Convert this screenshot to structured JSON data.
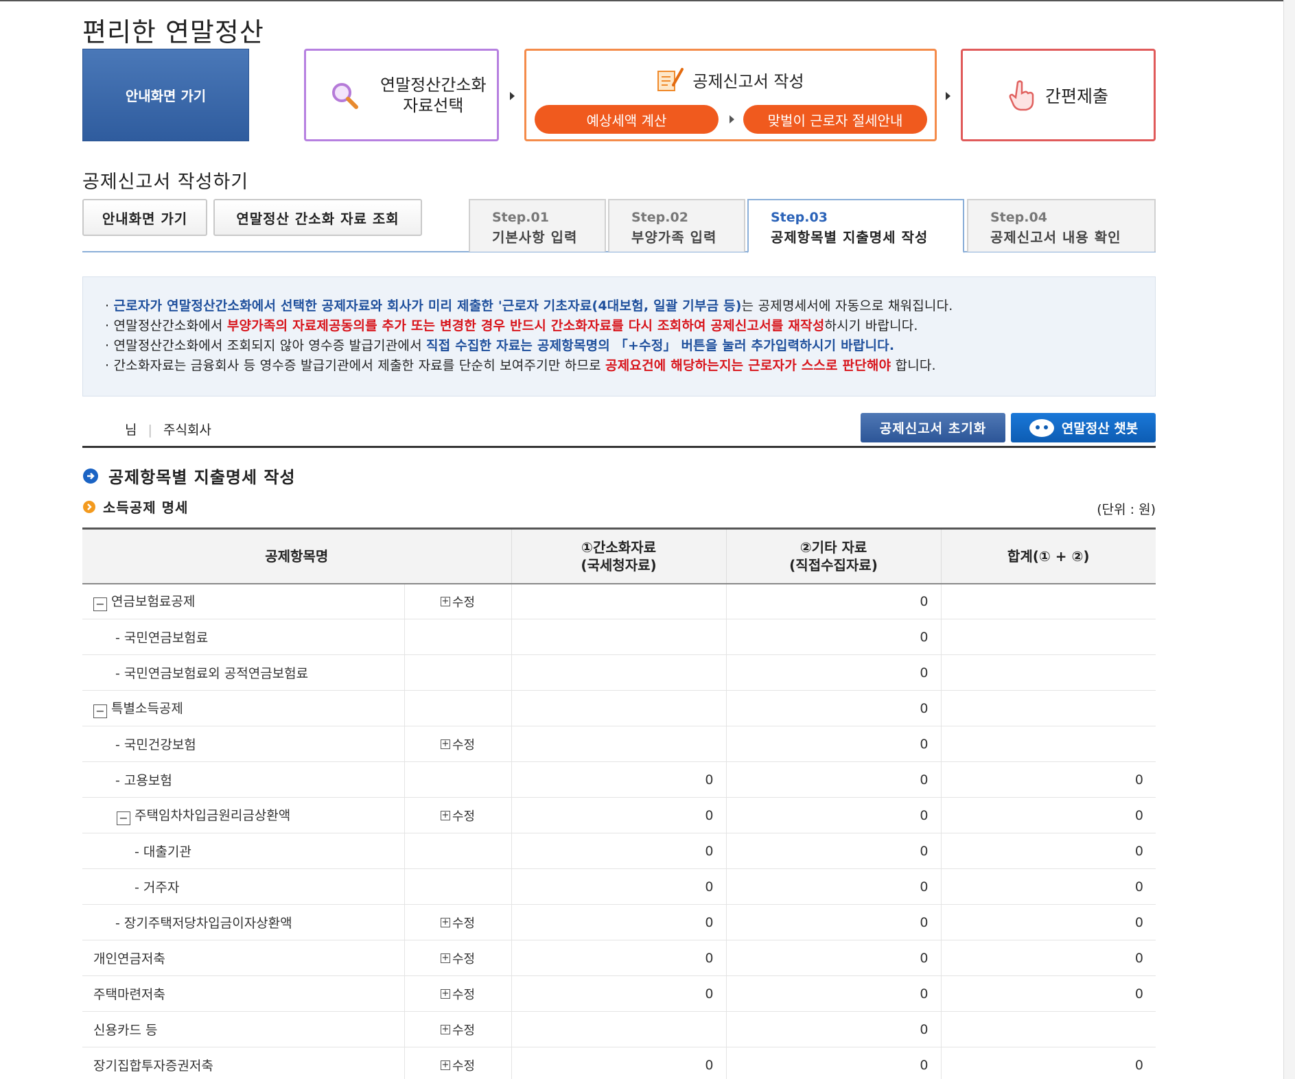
{
  "app_title": "편리한 연말정산",
  "process": {
    "guide_button": "안내화면 가기",
    "select_line1": "연말정산간소화",
    "select_line2": "자료선택",
    "write_title": "공제신고서 작성",
    "estimate_button": "예상세액 계산",
    "dual_income_button": "맞벌이 근로자 절세안내",
    "submit_label": "간편제출"
  },
  "section_title": "공제신고서 작성하기",
  "sub_buttons": {
    "guide": "안내화면 가기",
    "lookup": "연말정산 간소화 자료 조회"
  },
  "steps": [
    {
      "num": "Step.01",
      "title": "기본사항 입력"
    },
    {
      "num": "Step.02",
      "title": "부양가족 입력"
    },
    {
      "num": "Step.03",
      "title": "공제항목별 지출명세 작성"
    },
    {
      "num": "Step.04",
      "title": "공제신고서 내용 확인"
    }
  ],
  "notice": {
    "l1_blue": "근로자가 연말정산간소화에서 선택한 공제자료와 회사가 미리 제출한 '근로자 기초자료(4대보험, 일괄 기부금 등)",
    "l1_rest": "는 공제명세서에 자동으로 채워집니다.",
    "l2_a": "연말정산간소화에서 ",
    "l2_red1": "부양가족의 자료제공동의를 추가 또는 변경한 경우 반드시 간소화자료를 다시 조회하여 공제신고서를 재작성",
    "l2_b": "하시기 바랍니다.",
    "l3_a": "연말정산간소화에서 조회되지 않아 영수증 발급기관에서 ",
    "l3_blue": "직접 수집한 자료는 공제항목명의 「+수정」 버튼을 눌러 추가입력하시기 바랍니다.",
    "l4_a": "간소화자료는 금융회사 등 영수증 발급기관에서 제출한 자료를 단순히 보여주기만 하므로 ",
    "l4_red": "공제요건에 해당하는지는 근로자가 스스로 판단해야",
    "l4_b": " 합니다."
  },
  "user": {
    "name": "님",
    "separator": "|",
    "company": "주식회사"
  },
  "actions": {
    "reset": "공제신고서 초기화",
    "chatbot": "연말정산 챗봇"
  },
  "headings": {
    "main": "공제항목별 지출명세 작성",
    "sub": "소득공제 명세",
    "unit": "(단위 : 원)"
  },
  "table": {
    "headers": {
      "name": "공제항목명",
      "col1_l1": "①간소화자료",
      "col1_l2": "(국세청자료)",
      "col2_l1": "②기타 자료",
      "col2_l2": "(직접수집자료)",
      "total": "합계(① + ②)"
    },
    "edit_label": "수정",
    "rows": [
      {
        "name": "연금보험료공제",
        "level": 0,
        "toggle": "−",
        "edit": true,
        "c1": "",
        "c2": "0",
        "c3": ""
      },
      {
        "name": "- 국민연금보험료",
        "level": 1,
        "toggle": "",
        "edit": false,
        "c1": "",
        "c2": "0",
        "c3": ""
      },
      {
        "name": "- 국민연금보험료외 공적연금보험료",
        "level": 1,
        "toggle": "",
        "edit": false,
        "c1": "",
        "c2": "0",
        "c3": ""
      },
      {
        "name": "특별소득공제",
        "level": 0,
        "toggle": "−",
        "edit": false,
        "c1": "",
        "c2": "0",
        "c3": ""
      },
      {
        "name": "- 국민건강보험",
        "level": 1,
        "toggle": "",
        "edit": true,
        "c1": "",
        "c2": "0",
        "c3": ""
      },
      {
        "name": "- 고용보험",
        "level": 1,
        "toggle": "",
        "edit": false,
        "c1": "0",
        "c2": "0",
        "c3": "0"
      },
      {
        "name": "주택임차차입금원리금상환액",
        "level": 2,
        "toggle": "−",
        "edit": true,
        "c1": "0",
        "c2": "0",
        "c3": "0"
      },
      {
        "name": "- 대출기관",
        "level": 3,
        "toggle": "",
        "edit": false,
        "c1": "0",
        "c2": "0",
        "c3": "0"
      },
      {
        "name": "- 거주자",
        "level": 3,
        "toggle": "",
        "edit": false,
        "c1": "0",
        "c2": "0",
        "c3": "0"
      },
      {
        "name": "- 장기주택저당차입금이자상환액",
        "level": 1,
        "toggle": "",
        "edit": true,
        "c1": "0",
        "c2": "0",
        "c3": "0"
      },
      {
        "name": "개인연금저축",
        "level": 0,
        "toggle": "",
        "edit": true,
        "c1": "0",
        "c2": "0",
        "c3": "0"
      },
      {
        "name": "주택마련저축",
        "level": 0,
        "toggle": "",
        "edit": true,
        "c1": "0",
        "c2": "0",
        "c3": "0"
      },
      {
        "name": "신용카드 등",
        "level": 0,
        "toggle": "",
        "edit": true,
        "c1": "",
        "c2": "0",
        "c3": ""
      },
      {
        "name": "장기집합투자증권저축",
        "level": 0,
        "toggle": "",
        "edit": true,
        "c1": "0",
        "c2": "0",
        "c3": "0"
      }
    ]
  }
}
